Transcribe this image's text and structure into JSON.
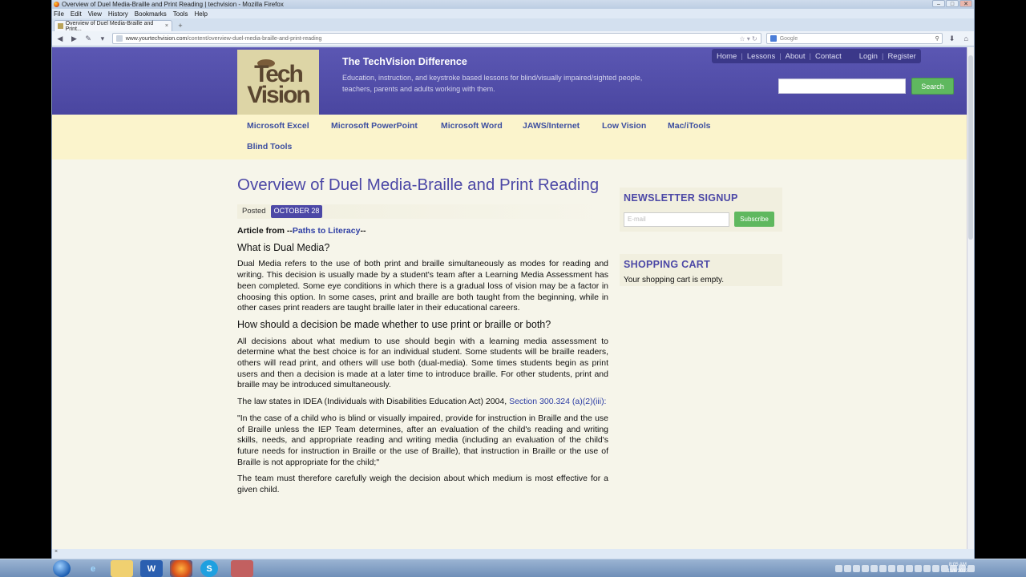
{
  "browser": {
    "window_title": "Overview of Duel Media-Braille and Print Reading | techvision - Mozilla Firefox",
    "menu": [
      "File",
      "Edit",
      "View",
      "History",
      "Bookmarks",
      "Tools",
      "Help"
    ],
    "tab_title": "Overview of Duel Media-Braille and Print...",
    "new_tab": "+",
    "url_host": "www.yourtechvision.com",
    "url_path": "/content/overview-duel-media-braille-and-print-reading",
    "search_engine_placeholder": "Google",
    "win_controls": [
      "–",
      "□",
      "✕"
    ]
  },
  "site": {
    "logo_line1": "Tech",
    "logo_line2": "Vision",
    "title": "The TechVision Difference",
    "tagline": "Education, instruction, and keystroke based lessons for blind/visually impaired/sighted people, teachers, parents and adults working with them.",
    "top_nav": [
      "Home",
      "Lessons",
      "About",
      "Contact"
    ],
    "account_nav": [
      "Login",
      "Register"
    ],
    "search_button": "Search",
    "categories": [
      "Microsoft Excel",
      "Microsoft PowerPoint",
      "Microsoft Word",
      "JAWS/Internet",
      "Low Vision",
      "Mac/iTools",
      "Blind Tools"
    ]
  },
  "article": {
    "title": "Overview of Duel Media-Braille and Print Reading",
    "posted_label": "Posted",
    "posted_date": "OCTOBER 28",
    "source_prefix": "Article from --",
    "source_link": "Paths to Literacy",
    "source_suffix": "--",
    "h_what": "What is Dual Media?",
    "p_what": "Dual Media refers to the use of both print and braille simultaneously as modes for reading and writing.  This decision is usually made by a student's team after a Learning Media Assessment has been completed.  Some eye conditions in which there is a gradual loss of vision may be a factor in choosing this option. In some cases, print and braille are both taught from the beginning, while in other cases print readers are taught braille later in their educational careers.",
    "h_how": "How should a decision be made whether to use print or braille or both?",
    "p_how": "All decisions about what medium to use should begin with a learning media assessment to determine what the best choice is for an individual student.  Some students will be braille readers, others will read print, and others will use both (dual-media).  Some times students begin as print users and then a decision is made at a later time to introduce braille.  For other students, print and braille may be introduced simultaneously.",
    "p_law_prefix": "The law states in IDEA (Individuals with Disabilities Education Act) 2004, ",
    "p_law_link": "Section 300.324 (a)(2)(iii):",
    "p_quote": "\"In the case of a child who is blind or visually impaired, provide for instruction in Braille and the use of Braille unless the IEP Team determines,  after an evaluation of the child's reading and writing skills, needs, and appropriate reading and writing media (including an evaluation of the child's future needs for instruction in Braille or the use of Braille), that instruction in Braille or the use of Braille is not appropriate for the child;\"",
    "p_team": "The team must therefore carefully weigh the decision about which medium is most effective for a given child."
  },
  "sidebar": {
    "newsletter_title": "NEWSLETTER SIGNUP",
    "email_placeholder": "E-mail",
    "subscribe": "Subscribe",
    "cart_title": "SHOPPING CART",
    "cart_text": "Your shopping cart is empty."
  },
  "taskbar": {
    "clock_time": "8:05 AM",
    "clock_date": "11/6/2013"
  },
  "colors": {
    "header_purple": "#4c48a6",
    "category_bg": "#fbf4cc",
    "link_blue": "#2f3fa4",
    "button_green": "#5fb85f"
  }
}
